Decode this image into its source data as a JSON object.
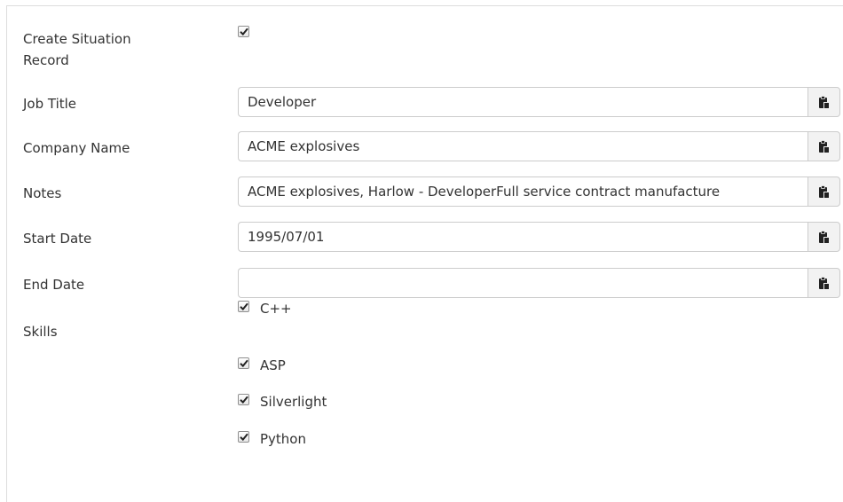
{
  "create_situation": {
    "label_line1": "Create Situation",
    "label_line2": "Record",
    "checked": true
  },
  "fields": {
    "job_title": {
      "label": "Job Title",
      "value": "Developer"
    },
    "company_name": {
      "label": "Company Name",
      "value": "ACME explosives"
    },
    "notes": {
      "label": "Notes",
      "value": "ACME explosives, Harlow - DeveloperFull service contract manufacture"
    },
    "start_date": {
      "label": "Start Date",
      "value": "1995/07/01"
    },
    "end_date": {
      "label": "End Date",
      "value": ""
    }
  },
  "skills": {
    "label": "Skills",
    "items": [
      {
        "label": "C++",
        "checked": true
      },
      {
        "label": "ASP",
        "checked": true
      },
      {
        "label": "Silverlight",
        "checked": true
      },
      {
        "label": "Python",
        "checked": true
      }
    ]
  },
  "icons": {
    "field_button": "paste-clipboard-icon",
    "checkbox_mark": "checkmark-icon"
  },
  "colors": {
    "text": "#333333",
    "border": "#cccccc",
    "button_bg": "#f2f2f2"
  }
}
